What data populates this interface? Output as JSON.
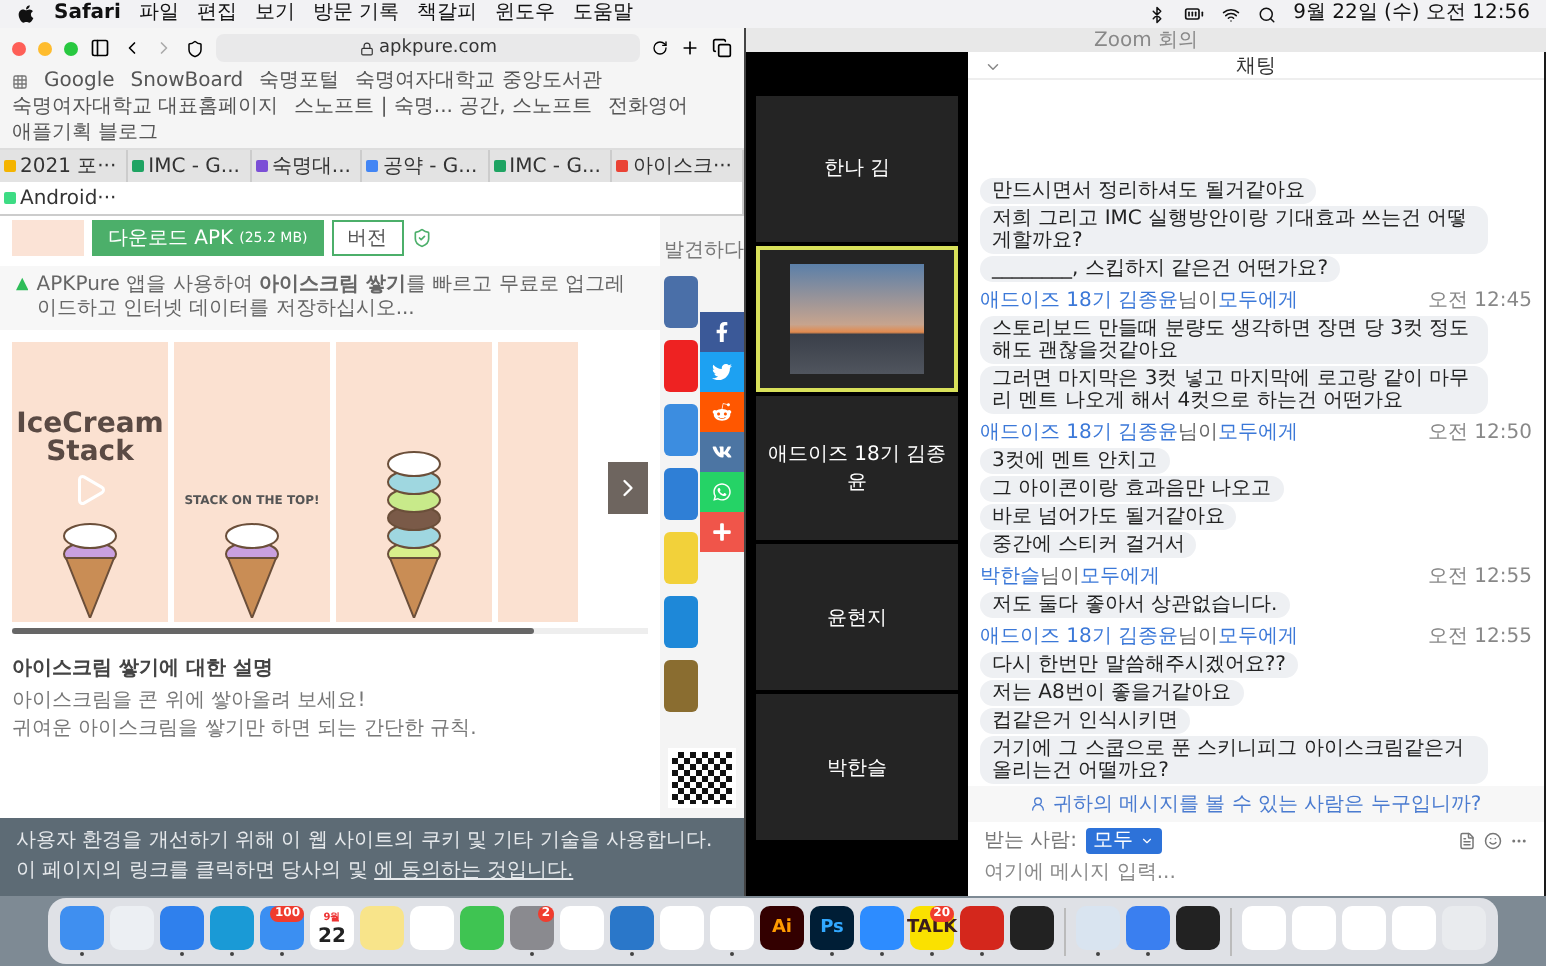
{
  "menubar": {
    "app": "Safari",
    "items": [
      "파일",
      "편집",
      "보기",
      "방문 기록",
      "책갈피",
      "윈도우",
      "도움말"
    ],
    "clock": "9월 22일 (수) 오전 12:56"
  },
  "safari": {
    "address": "apkpure.com",
    "bookmarks": [
      "Google",
      "SnowBoard",
      "숙명포털",
      "숙명여자대학교 중앙도서관",
      "숙명여자대학교 대표홈페이지",
      "스노프트 | 숙명... 공간, 스노프트",
      "전화영어",
      "애플기획 블로그"
    ],
    "tabs": [
      {
        "label": "2021 포···",
        "color": "#f4b400",
        "selected": false
      },
      {
        "label": "IMC - G...",
        "color": "#1fa463",
        "selected": false
      },
      {
        "label": "숙명대...",
        "color": "#7b4fd6",
        "selected": false
      },
      {
        "label": "공약 - G...",
        "color": "#4285f4",
        "selected": false
      },
      {
        "label": "IMC - G...",
        "color": "#1fa463",
        "selected": false
      },
      {
        "label": "아이스크···",
        "color": "#ea4335",
        "selected": false
      },
      {
        "label": "Android···",
        "color": "#3ddc84",
        "selected": true
      }
    ],
    "download": {
      "label": "다운로드 APK",
      "size": "(25.2 MB)",
      "version": "버전"
    },
    "promo": "APKPure 앱을 사용하여 **아이스크림 쌓기**를 빠르고 무료로 업그레이드하고 인터넷 데이터를 저장하십시오...",
    "screenshots": [
      {
        "kind": "title",
        "title": "IceCream Stack"
      },
      {
        "kind": "caption",
        "caption": "STACK ON THE TOP!"
      },
      {
        "kind": "tower"
      },
      {
        "kind": "partial"
      }
    ],
    "description": {
      "heading": "아이스크림 쌓기에 대한 설명",
      "lines": [
        "아이스크림을 콘 위에 쌓아올려 보세요!",
        "귀여운 아이스크림을 쌓기만 하면 되는 간단한 규칙."
      ]
    },
    "sidebar": {
      "heading": "발견하다"
    },
    "share": [
      {
        "kind": "facebook"
      },
      {
        "kind": "twitter"
      },
      {
        "kind": "reddit"
      },
      {
        "kind": "vk"
      },
      {
        "kind": "whatsapp"
      },
      {
        "kind": "more"
      }
    ],
    "cookie": {
      "line1": "사용자 환경을 개선하기 위해 이 웹 사이트의 쿠키 및 기타 기술을 사용합니다.",
      "line2": "이 페이지의 링크를 클릭하면 당사의 및",
      "link": "에 동의하는 것입니다."
    }
  },
  "zoom": {
    "title": "Zoom 회의",
    "participants": [
      {
        "kind": "name",
        "name": "한나 김",
        "speaking": false
      },
      {
        "kind": "video",
        "speaking": true
      },
      {
        "kind": "name",
        "name": "애드이즈 18기 김종윤",
        "speaking": false
      },
      {
        "kind": "name",
        "name": "윤현지",
        "speaking": false
      },
      {
        "kind": "name",
        "name": "박한슬",
        "speaking": false
      }
    ]
  },
  "chat": {
    "title": "채팅",
    "items": [
      {
        "kind": "message",
        "text": "만드시면서 정리하셔도 될거같아요"
      },
      {
        "kind": "message",
        "text": "저희 그리고 IMC 실행방안이랑 기대효과 쓰는건 어떻게할까요?"
      },
      {
        "kind": "message",
        "text": "________, 스킵하지 같은건 어떤가요?"
      },
      {
        "kind": "sender",
        "from": "애드이즈 18기 김종윤",
        "via": "님이",
        "to": "모두에게",
        "time": "오전 12:45"
      },
      {
        "kind": "message",
        "text": "스토리보드 만들때 분량도 생각하면 장면 당 3컷 정도 해도 괜찮을것같아요"
      },
      {
        "kind": "message",
        "text": "그러면 마지막은 3컷 넣고 마지막에 로고랑 같이 마무리 멘트 나오게 해서 4컷으로 하는건 어떤가요"
      },
      {
        "kind": "sender",
        "from": "애드이즈 18기 김종윤",
        "via": "님이",
        "to": "모두에게",
        "time": "오전 12:50"
      },
      {
        "kind": "message",
        "text": "3컷에 멘트 안치고"
      },
      {
        "kind": "message",
        "text": "그 아이콘이랑 효과음만 나오고"
      },
      {
        "kind": "message",
        "text": "바로 넘어가도 될거같아요"
      },
      {
        "kind": "message",
        "text": "중간에 스티커 걸거서"
      },
      {
        "kind": "sender",
        "from": "박한슬",
        "via": "님이",
        "to": "모두에게",
        "time": "오전 12:55"
      },
      {
        "kind": "message",
        "text": "저도 둘다 좋아서 상관없습니다."
      },
      {
        "kind": "sender",
        "from": "애드이즈 18기 김종윤",
        "via": "님이",
        "to": "모두에게",
        "time": "오전 12:55"
      },
      {
        "kind": "message",
        "text": "다시 한번만 말씀해주시겠어요??"
      },
      {
        "kind": "message",
        "text": "저는 A8번이 좋을거같아요"
      },
      {
        "kind": "message",
        "text": "컵같은거 인식시키면"
      },
      {
        "kind": "message",
        "text": "거기에 그 스쿱으로 푼 스키니피그 아이스크림같은거 올리는건 어떨까요?"
      }
    ],
    "notice": "귀하의 메시지를 볼 수 있는 사람은 누구입니까?",
    "recipient_label": "받는 사람:",
    "recipient": "모두",
    "placeholder": "여기에 메시지 입력..."
  },
  "dock": {
    "items": [
      {
        "kind": "finder",
        "running": true
      },
      {
        "kind": "launchpad",
        "running": false
      },
      {
        "kind": "safari",
        "running": true
      },
      {
        "kind": "edge",
        "running": true
      },
      {
        "kind": "mail",
        "badge": "100",
        "running": true
      },
      {
        "kind": "calendar",
        "month": "9월",
        "day": "22",
        "running": false
      },
      {
        "kind": "notes",
        "running": false
      },
      {
        "kind": "photos",
        "running": false
      },
      {
        "kind": "messages",
        "running": false
      },
      {
        "kind": "settings",
        "badge": "2",
        "running": true
      },
      {
        "kind": "pencil",
        "running": false
      },
      {
        "kind": "files",
        "running": true
      },
      {
        "kind": "word",
        "running": false
      },
      {
        "kind": "powerpoint",
        "running": true
      },
      {
        "kind": "letters",
        "label": "Ai",
        "running": false
      },
      {
        "kind": "letters2",
        "label": "Ps",
        "running": true
      },
      {
        "kind": "camera",
        "running": true
      },
      {
        "kind": "talk",
        "label": "TALK",
        "badge": "20",
        "running": true
      },
      {
        "kind": "acrobat",
        "running": true
      },
      {
        "kind": "terminal",
        "running": false
      },
      {
        "kind": "separator"
      },
      {
        "kind": "preview",
        "running": true
      },
      {
        "kind": "dots",
        "running": true
      },
      {
        "kind": "radar",
        "running": false
      },
      {
        "kind": "separator"
      },
      {
        "kind": "window",
        "running": false
      },
      {
        "kind": "window",
        "running": false
      },
      {
        "kind": "window",
        "running": false
      },
      {
        "kind": "window",
        "running": false
      },
      {
        "kind": "trash",
        "running": false
      }
    ]
  }
}
